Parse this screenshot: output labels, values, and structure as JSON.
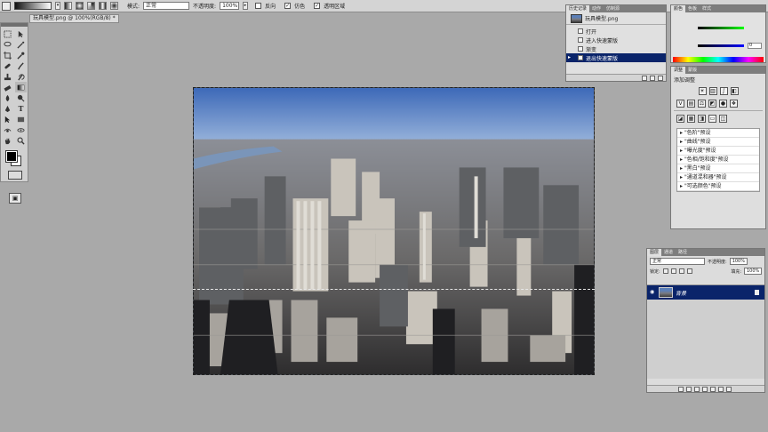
{
  "options_bar": {
    "mode_label": "模式:",
    "mode_value": "正常",
    "opacity_label": "不透明度:",
    "opacity_value": "100%",
    "reverse_label": "反向",
    "dither_label": "仿色",
    "transparency_label": "透明区域"
  },
  "document": {
    "tab_title": "玩具模型.png @ 100%(RGB/8) *"
  },
  "history_panel": {
    "tabs": [
      "历史记录",
      "动作",
      "仿制源"
    ],
    "snapshot_label": "玩具模型.png",
    "states": [
      "打开",
      "进入快速蒙版",
      "渐变",
      "退出快速蒙版"
    ]
  },
  "color_panel": {
    "tabs": [
      "颜色",
      "色板",
      "样式"
    ],
    "b_value": "0"
  },
  "adjustments_panel": {
    "tabs": [
      "调整",
      "蒙版"
    ],
    "title": "添加调整",
    "presets": [
      "\"色阶\"预设",
      "\"曲线\"预设",
      "\"曝光度\"预设",
      "\"色相/饱和度\"预设",
      "\"黑白\"预设",
      "\"通道混和器\"预设",
      "\"可选颜色\"预设"
    ]
  },
  "layers_panel": {
    "tabs": [
      "图层",
      "通道",
      "路径"
    ],
    "blend_mode": "正常",
    "opacity_label": "不透明度:",
    "opacity_value": "100%",
    "lock_label": "锁定:",
    "fill_label": "填充:",
    "fill_value": "100%",
    "layer_name": "背景"
  },
  "colors": {
    "foreground": "#000000",
    "background": "#ffffff",
    "selection_highlight": "#0a246a"
  }
}
